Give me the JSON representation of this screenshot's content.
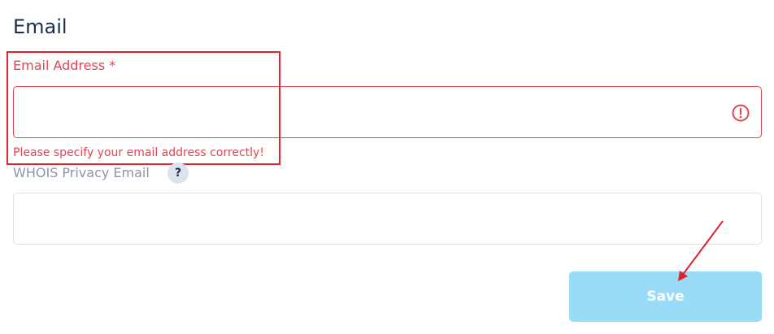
{
  "section": {
    "title": "Email"
  },
  "email_field": {
    "label": "Email Address *",
    "value": "",
    "error": "Please specify your email address correctly!",
    "status_icon": "alert-circle-icon"
  },
  "whois_field": {
    "label": "WHOIS Privacy Email",
    "help_badge": "?",
    "value": ""
  },
  "actions": {
    "save_label": "Save"
  },
  "colors": {
    "error": "#e04552",
    "annotation": "#e0232c",
    "title": "#1d2b4f",
    "muted_label": "#8c96a6",
    "button_disabled": "#9adcf8"
  }
}
